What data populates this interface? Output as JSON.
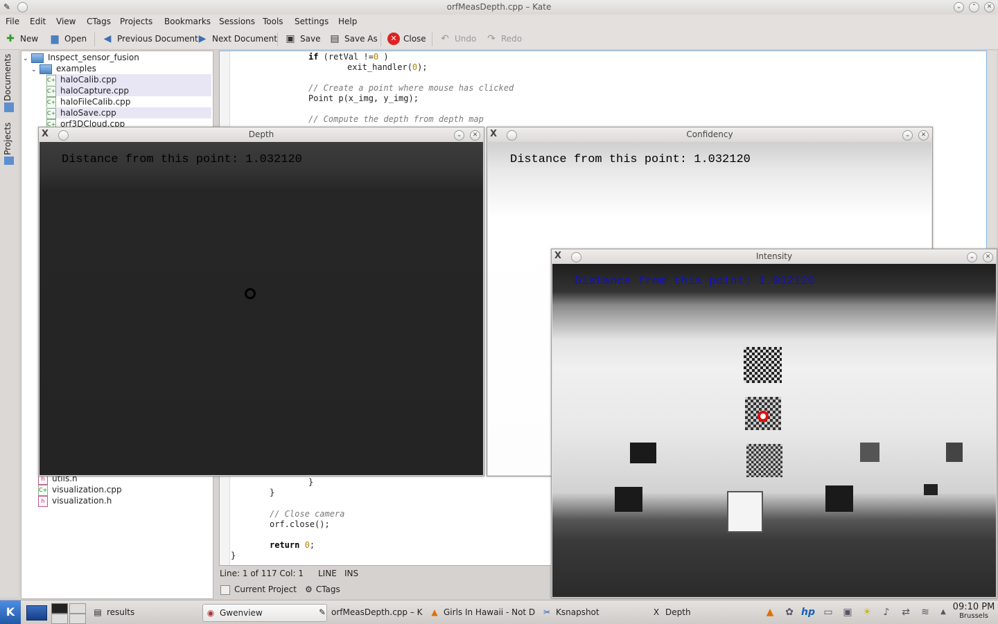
{
  "window": {
    "title": "orfMeasDepth.cpp – Kate"
  },
  "menu": [
    "File",
    "Edit",
    "View",
    "CTags",
    "Projects",
    "Bookmarks",
    "Sessions",
    "Tools",
    "Settings",
    "Help"
  ],
  "toolbar": {
    "new": "New",
    "open": "Open",
    "prev_doc": "Previous Document",
    "next_doc": "Next Document",
    "save": "Save",
    "save_as": "Save As",
    "close": "Close",
    "undo": "Undo",
    "redo": "Redo"
  },
  "side_tabs": {
    "documents": "Documents",
    "projects": "Projects"
  },
  "file_tree": {
    "project": "Inspect_sensor_fusion",
    "folder": "examples",
    "files": [
      "haloCalib.cpp",
      "haloCapture.cpp",
      "haloFileCalib.cpp",
      "haloSave.cpp",
      "orf3DCloud.cpp"
    ],
    "bottom_files": [
      "utils.h",
      "visualization.cpp",
      "visualization.h"
    ]
  },
  "code": {
    "l1_kw": "if",
    "l1_rest": " (retVal !=",
    "l1_num": "0",
    "l1_end": " )",
    "l2": "exit_handler(",
    "l2_num": "0",
    "l2_end": ");",
    "l3": "// Create a point where mouse has clicked",
    "l4": "Point p(x_img, y_img);",
    "l5": "// Compute the depth from depth map",
    "l6": "}",
    "l7": "}",
    "l8": "// Close camera",
    "l9": "orf.close();",
    "l10_kw": "return",
    "l10_num": "0",
    "l10_end": ";",
    "l11": "}"
  },
  "status": {
    "position": "Line: 1 of 117 Col: 1",
    "mode": "LINE",
    "ins": "INS"
  },
  "bottom_tabs": {
    "current_project": "Current Project",
    "ctags": "CTags"
  },
  "depth_window": {
    "title": "Depth",
    "overlay": "Distance from this point: 1.032120"
  },
  "confidency_window": {
    "title": "Confidency",
    "overlay": "Distance from this point: 1.032120"
  },
  "intensity_window": {
    "title": "Intensity",
    "overlay": "Distance from this point: 1.032120"
  },
  "taskbar": {
    "tasks": [
      "results",
      "Gwenview",
      "orfMeasDepth.cpp – K",
      "Girls In Hawaii - Not D",
      "Ksnapshot",
      "Depth"
    ],
    "clock": "09:10 PM",
    "city": "Brussels"
  },
  "colors": {
    "accent": "#7fb3e6",
    "overlay_blue": "#1010c8",
    "marker_red": "#e01010"
  }
}
